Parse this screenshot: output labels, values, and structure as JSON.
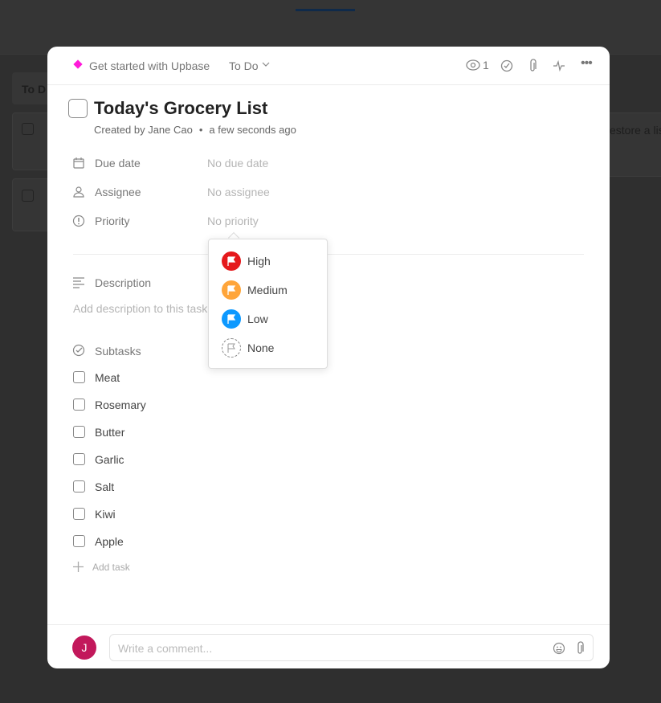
{
  "background": {
    "column_title": "To D",
    "card_fragment": "estore a lis"
  },
  "header": {
    "project": "Get started with Upbase",
    "project_color": "#ff1ad9",
    "status": "To Do",
    "watchers_count": "1"
  },
  "task": {
    "title": "Today's Grocery List",
    "created_by": "Created by Jane Cao",
    "created_time": "a few seconds ago"
  },
  "fields": [
    {
      "label": "Due date",
      "value": "No due date",
      "icon": "calendar-icon"
    },
    {
      "label": "Assignee",
      "value": "No assignee",
      "icon": "user-icon"
    },
    {
      "label": "Priority",
      "value": "No priority",
      "icon": "priority-icon"
    }
  ],
  "priority_menu": [
    {
      "label": "High",
      "color": "#e5191c"
    },
    {
      "label": "Medium",
      "color": "#ffa53a"
    },
    {
      "label": "Low",
      "color": "#0d99ff"
    },
    {
      "label": "None",
      "color": "#999999"
    }
  ],
  "description": {
    "label": "Description",
    "placeholder": "Add description to this task"
  },
  "subtasks": {
    "label": "Subtasks",
    "items": [
      "Meat",
      "Rosemary",
      "Butter",
      "Garlic",
      "Salt",
      "Kiwi",
      "Apple"
    ],
    "add_label": "Add task"
  },
  "comment": {
    "avatar_initial": "J",
    "avatar_color": "#c2185b",
    "placeholder": "Write a comment..."
  }
}
